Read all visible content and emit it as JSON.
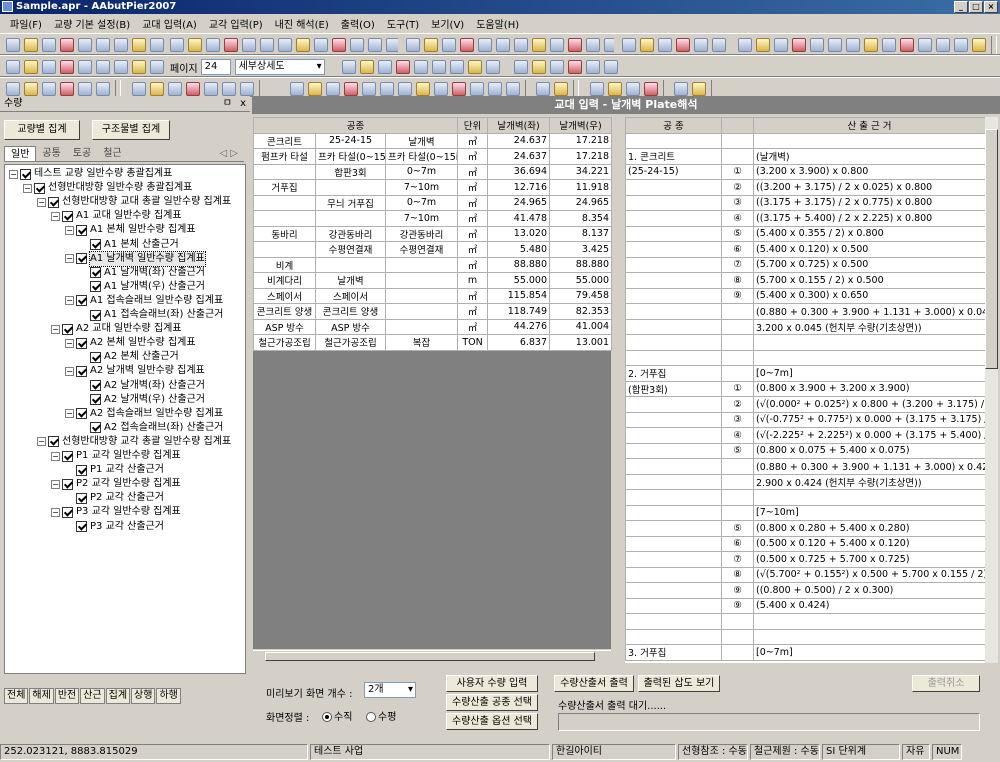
{
  "window": {
    "title": "Sample.apr - AAbutPier2007"
  },
  "menu": [
    "파일(F)",
    "교량 기본 설정(B)",
    "교대 입력(A)",
    "교각 입력(P)",
    "내진 해석(E)",
    "출력(O)",
    "도구(T)",
    "보기(V)",
    "도움말(H)"
  ],
  "toolbar": {
    "page_label": "페이지",
    "page_value": "24",
    "view_select": "세부상세도"
  },
  "left_panel": {
    "title": "수량",
    "pin": "ㅁ",
    "close": "x",
    "btn_bridge": "교량별 집계",
    "btn_struct": "구조물별 집계",
    "tabs": [
      "일반",
      "공통",
      "토공",
      "철근"
    ],
    "tab_arrows": "◁ ▷",
    "tree": [
      {
        "label": "테스트 교량 일반수량 총괄집계표",
        "lvl": 0,
        "exp": true
      },
      {
        "label": "선형반대방향 일반수량 총괄집계표",
        "lvl": 1,
        "exp": true
      },
      {
        "label": "선형반대방향 교대 총괄 일반수량 집계표",
        "lvl": 2,
        "exp": true
      },
      {
        "label": "A1 교대 일반수량 집계표",
        "lvl": 3,
        "exp": true
      },
      {
        "label": "A1 본체 일반수량 집계표",
        "lvl": 4,
        "exp": true
      },
      {
        "label": "A1 본체 산출근거",
        "lvl": 5,
        "exp": null
      },
      {
        "label": "A1 날개벽 일반수량 집계표",
        "lvl": 4,
        "exp": true,
        "sel": true
      },
      {
        "label": "A1 날개벽(좌) 산출근거",
        "lvl": 5,
        "exp": null
      },
      {
        "label": "A1 날개벽(우) 산출근거",
        "lvl": 5,
        "exp": null
      },
      {
        "label": "A1 접속슬래브 일반수량 집계표",
        "lvl": 4,
        "exp": true
      },
      {
        "label": "A1 접속슬래브(좌) 산출근거",
        "lvl": 5,
        "exp": null
      },
      {
        "label": "A2 교대 일반수량 집계표",
        "lvl": 3,
        "exp": true
      },
      {
        "label": "A2 본체 일반수량 집계표",
        "lvl": 4,
        "exp": true
      },
      {
        "label": "A2 본체 산출근거",
        "lvl": 5,
        "exp": null
      },
      {
        "label": "A2 날개벽 일반수량 집계표",
        "lvl": 4,
        "exp": true
      },
      {
        "label": "A2 날개벽(좌) 산출근거",
        "lvl": 5,
        "exp": null
      },
      {
        "label": "A2 날개벽(우) 산출근거",
        "lvl": 5,
        "exp": null
      },
      {
        "label": "A2 접속슬래브 일반수량 집계표",
        "lvl": 4,
        "exp": true
      },
      {
        "label": "A2 접속슬래브(좌) 산출근거",
        "lvl": 5,
        "exp": null
      },
      {
        "label": "선형반대방향 교각 총괄 일반수량 집계표",
        "lvl": 2,
        "exp": true
      },
      {
        "label": "P1 교각 일반수량 집계표",
        "lvl": 3,
        "exp": true
      },
      {
        "label": "P1 교각 산출근거",
        "lvl": 4,
        "exp": null
      },
      {
        "label": "P2 교각 일반수량 집계표",
        "lvl": 3,
        "exp": true
      },
      {
        "label": "P2 교각 산출근거",
        "lvl": 4,
        "exp": null
      },
      {
        "label": "P3 교각 일반수량 집계표",
        "lvl": 3,
        "exp": true
      },
      {
        "label": "P3 교각 산출근거",
        "lvl": 4,
        "exp": null
      }
    ],
    "bottom_tabs": [
      "전체",
      "해제",
      "반전",
      "산근",
      "집계",
      "상행",
      "하행"
    ]
  },
  "content": {
    "header": "교대 입력 - 날개벽 Plate해석"
  },
  "qty_table": {
    "headers": [
      "공종",
      "단위",
      "날개벽(좌)",
      "날개벽(우)"
    ],
    "rows": [
      [
        "콘크리트",
        "25-24-15",
        "날개벽",
        "㎥",
        "24.637",
        "17.218"
      ],
      [
        "펌프카 타설",
        "프카 타설(0~15i",
        "프카 타설(0~15i",
        "㎥",
        "24.637",
        "17.218"
      ],
      [
        "",
        "합판3회",
        "0~7m",
        "㎡",
        "36.694",
        "34.221"
      ],
      [
        "거푸집",
        "",
        "7~10m",
        "㎡",
        "12.716",
        "11.918"
      ],
      [
        "",
        "무늬 거푸집",
        "0~7m",
        "㎡",
        "24.965",
        "24.965"
      ],
      [
        "",
        "",
        "7~10m",
        "㎡",
        "41.478",
        "8.354"
      ],
      [
        "동바리",
        "강관동바리",
        "강관동바리",
        "㎥",
        "13.020",
        "8.137"
      ],
      [
        "",
        "수평연결재",
        "수평연결재",
        "㎡",
        "5.480",
        "3.425"
      ],
      [
        "비계",
        "",
        "",
        "㎡",
        "88.880",
        "88.880"
      ],
      [
        "비계다리",
        "날개벽",
        "",
        "m",
        "55.000",
        "55.000"
      ],
      [
        "스페이서",
        "스페이서",
        "",
        "㎡",
        "115.854",
        "79.458"
      ],
      [
        "콘크리트 양생",
        "콘크리트 양생",
        "",
        "㎡",
        "118.749",
        "82.353"
      ],
      [
        "ASP 방수",
        "ASP 방수",
        "",
        "㎡",
        "44.276",
        "41.004"
      ],
      [
        "철근가공조립",
        "철근가공조립",
        "복잡",
        "TON",
        "6.837",
        "13.001"
      ]
    ]
  },
  "basis_table": {
    "headers": [
      "공 종",
      "",
      "산 출 근 거"
    ],
    "rows": [
      [
        "",
        "",
        ""
      ],
      [
        "1. 콘크리트",
        "",
        "(날개벽)"
      ],
      [
        "(25-24-15)",
        "①",
        "(3.200 x 3.900) x 0.800"
      ],
      [
        "",
        "②",
        "((3.200 + 3.175) / 2 x 0.025) x 0.800"
      ],
      [
        "",
        "③",
        "((3.175 + 3.175) / 2 x 0.775) x 0.800"
      ],
      [
        "",
        "④",
        "((3.175 + 5.400) / 2 x 2.225) x 0.800"
      ],
      [
        "",
        "⑤",
        "(5.400 x 0.355 / 2) x 0.800"
      ],
      [
        "",
        "⑥",
        "(5.400 x 0.120) x 0.500"
      ],
      [
        "",
        "⑦",
        "(5.700 x 0.725) x 0.500"
      ],
      [
        "",
        "⑧",
        "(5.700 x 0.155 / 2) x 0.500"
      ],
      [
        "",
        "⑨",
        "(5.400 x 0.300) x 0.650"
      ],
      [
        "",
        "",
        "(0.880 + 0.300 + 3.900 + 1.131 + 3.000) x 0.045 (헌치부 수"
      ],
      [
        "",
        "",
        "3.200 x 0.045 (헌치부 수량(기초상면))"
      ],
      [
        "",
        "",
        ""
      ],
      [
        "",
        "",
        ""
      ],
      [
        "2. 거푸집",
        "",
        "[0~7m]"
      ],
      [
        "(합판3회)",
        "①",
        "(0.800 x 3.900 + 3.200 x 3.900)"
      ],
      [
        "",
        "②",
        "(√(0.000² + 0.025²) x 0.800 + (3.200 + 3.175) / 2 x 0.025)"
      ],
      [
        "",
        "③",
        "(√(-0.775² + 0.775²) x 0.000 + (3.175 + 3.175) / 2 x 0.775)"
      ],
      [
        "",
        "④",
        "(√(-2.225² + 2.225²) x 0.000 + (3.175 + 5.400) / 2 x 2.225)"
      ],
      [
        "",
        "⑤",
        "(0.800 x 0.075 + 5.400 x 0.075)"
      ],
      [
        "",
        "",
        "(0.880 + 0.300 + 3.900 + 1.131 + 3.000) x 0.424 (헌치부 수"
      ],
      [
        "",
        "",
        "2.900 x 0.424 (헌치부 수량(기초상면))"
      ],
      [
        "",
        "",
        ""
      ],
      [
        "",
        "",
        "[7~10m]"
      ],
      [
        "",
        "⑤",
        "(0.800 x 0.280 + 5.400 x 0.280)"
      ],
      [
        "",
        "⑥",
        "(0.500 x 0.120 + 5.400 x 0.120)"
      ],
      [
        "",
        "⑦",
        "(0.500 x 0.725 + 5.700 x 0.725)"
      ],
      [
        "",
        "⑧",
        "(√(5.700² + 0.155²) x 0.500 + 5.700 x 0.155 / 2)"
      ],
      [
        "",
        "⑨",
        "((0.800 + 0.500) / 2 x 0.300)"
      ],
      [
        "",
        "⑨",
        "(5.400 x 0.424)"
      ],
      [
        "",
        "",
        ""
      ],
      [
        "",
        "",
        ""
      ],
      [
        "3. 거푸집",
        "",
        "[0~7m]"
      ]
    ]
  },
  "controls": {
    "preview_label": "미리보기 화면 개수 :",
    "preview_value": "2개",
    "sort_label": "화면정렬 :",
    "sort_vertical": "수직",
    "sort_horizontal": "수평",
    "btn_user_input": "사용자 수량 입력",
    "btn_work_select": "수량산출 공종 선택",
    "btn_option_select": "수량산출 옵션 선택",
    "btn_print_sheet": "수량산출서 출력",
    "btn_print_drawing": "출력된 삽도 보기",
    "btn_cancel_print": "출력취소",
    "status_msg": "수량산출서 출력 대기......"
  },
  "statusbar": {
    "coords": "252.023121,    8883.815029",
    "project": "테스트 사업",
    "company": "한길아이티",
    "line_ref": "선형참조 : 수동",
    "rebar": "철근제원 : 수동",
    "unit": "SI 단위계",
    "free": "자유",
    "num": "NUM"
  }
}
